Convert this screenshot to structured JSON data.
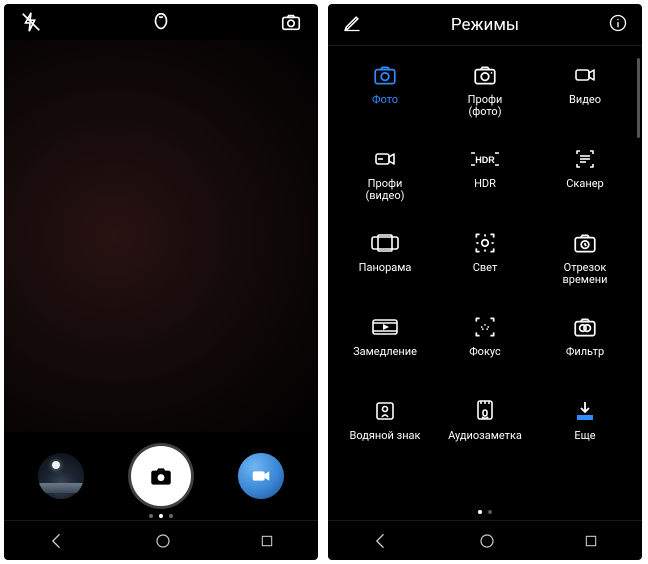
{
  "left": {
    "topbar": {
      "flash_icon": "flash-off",
      "center_icon": "beauty-mode",
      "switch_icon": "camera-switch"
    },
    "shutter_row": {
      "thumbnail": "gallery-thumbnail",
      "shutter": "shutter",
      "mode_switch": "video-mode"
    },
    "page_dots": {
      "count": 3,
      "active": 1
    }
  },
  "right": {
    "header": {
      "edit_icon": "edit",
      "title": "Режимы",
      "info_icon": "info"
    },
    "modes": [
      {
        "id": "photo",
        "label": "Фото",
        "icon": "camera",
        "active": true
      },
      {
        "id": "pro-photo",
        "label": "Профи\n(фото)",
        "icon": "camera-pro"
      },
      {
        "id": "video",
        "label": "Видео",
        "icon": "video"
      },
      {
        "id": "pro-video",
        "label": "Профи\n(видео)",
        "icon": "video-pro"
      },
      {
        "id": "hdr",
        "label": "HDR",
        "icon": "hdr"
      },
      {
        "id": "scanner",
        "label": "Сканер",
        "icon": "scan"
      },
      {
        "id": "panorama",
        "label": "Панорама",
        "icon": "pano"
      },
      {
        "id": "light",
        "label": "Свет",
        "icon": "light"
      },
      {
        "id": "timelapse",
        "label": "Отрезок\nвремени",
        "icon": "camera-clock"
      },
      {
        "id": "slowmo",
        "label": "Замедление",
        "icon": "slomo"
      },
      {
        "id": "focus",
        "label": "Фокус",
        "icon": "focus"
      },
      {
        "id": "filter",
        "label": "Фильтр",
        "icon": "filter"
      },
      {
        "id": "watermark",
        "label": "Водяной знак",
        "icon": "watermark"
      },
      {
        "id": "audionote",
        "label": "Аудиозаметка",
        "icon": "audionote"
      },
      {
        "id": "more",
        "label": "Еще",
        "icon": "download"
      }
    ],
    "pager": {
      "count": 2,
      "active": 0
    }
  },
  "navbar": {
    "back": "back",
    "home": "home",
    "recent": "recent"
  }
}
